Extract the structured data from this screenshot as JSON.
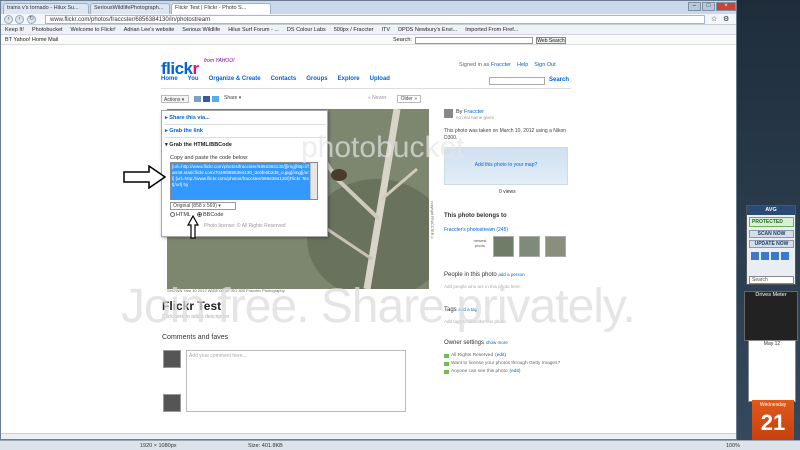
{
  "browser": {
    "tabs": [
      {
        "label": "trains v's tornado - Hilux Su..."
      },
      {
        "label": "SeriousWildlifePhotograph..."
      },
      {
        "label": "Flickr Test | Flickr - Photo S..."
      }
    ],
    "url": "www.flickr.com/photos/fraccster/6856384130/in/photostream",
    "bookmarks": [
      "Keep It!",
      "Photobucket",
      "Welcome to Flickr!",
      "Adrian Lee's website",
      "Serious Wildlife",
      "Hilux Surf Forum - ...",
      "DS Colour Labs",
      "500px / Fraccter",
      "ITV",
      "DPDS Newbury's Envi...",
      "Imported From Firef..."
    ],
    "yahoo_links": "BT Yahoo! Home    Mail",
    "search_label": "Search:",
    "web_search_btn": "Web Search"
  },
  "flickr": {
    "logo_a": "flick",
    "logo_b": "r",
    "byline": "from YAHOO!",
    "nav": [
      "Home",
      "You",
      "Organize & Create",
      "Contacts",
      "Groups",
      "Explore",
      "Upload"
    ],
    "signed_in": "Signed in as",
    "user": "Fraccter",
    "help": "Help",
    "signout": "Sign Out",
    "search_btn": "Search"
  },
  "toolbar": {
    "actions": "Actions",
    "share": "Share",
    "newer": "Newer",
    "older": "Older"
  },
  "share_dialog": {
    "share_via": "Share this via...",
    "grab_link": "Grab the link",
    "grab_html": "Grab the HTML/BBCode",
    "copy_label": "Copy and paste the code below:",
    "code": "[url=http://www.flickr.com/photos/fraccster/6856384130/][img]http://farm8.staticflickr.com/7049/6856384130_3c6fe5b2d8_o.jpg[/img][/url] [url=http://www.flickr.com/photos/fraccster/6856384130/]Flickr Test[/url] by",
    "size": "Original (858 x 569)",
    "html": "HTML",
    "bbcode": "BBCode",
    "license_label": "Photo license:",
    "license": "All Rights Reserved"
  },
  "photo": {
    "caption": "SHOWN 'Mar 10 2012 WIDE 00 50 ISO 400 Fraccter Photography",
    "side_caption": "copyright FRACCTER ©",
    "title": "Flickr Test",
    "add_desc": "Click here to add a description",
    "comments_heading": "Comments and faves",
    "comment_placeholder": "Add your comment here..."
  },
  "sidebar": {
    "by": "By",
    "owner": "Fraccter",
    "owner_sub": "no real name given",
    "taken": "This photo was taken on March 10, 2012 using a Nikon D300.",
    "add_map": "Add this photo to your map?",
    "views": "0 views",
    "belongs": "This photo belongs to",
    "stream": "Fraccter's photostream (245)",
    "newest": "newest photo",
    "people_h": "People in this photo",
    "add_person": "add a person",
    "people_d": "Add people who are in this photo here.",
    "tags_h": "Tags",
    "add_tag": "add a tag",
    "tags_d": "Add tags to describe this photo.",
    "owner_settings": "Owner settings",
    "show_more": "show more",
    "perm1": "All Rights Reserved",
    "perm2": "Want to license your photos through Getty Images?",
    "perm3": "Anyone can see this photo",
    "edit": "(edit)"
  },
  "status": {
    "dims": "1920 × 1080px",
    "size": "Size: 401.8KB",
    "zoom": "100%"
  },
  "desktop": {
    "avg": "AVG",
    "protected": "PROTECTED",
    "scan": "SCAN NOW",
    "update": "UPDATE NOW",
    "search": "Search",
    "meter": "Drives Meter",
    "cal_month": "May 12",
    "weekday": "Wednesday",
    "day": "21"
  },
  "watermark": {
    "main": "Join free. Share privately.",
    "logo": "photobucket"
  },
  "colors": {
    "flickr_blue": "#0063dc",
    "flickr_pink": "#ff0084",
    "selection": "#3399ff"
  }
}
